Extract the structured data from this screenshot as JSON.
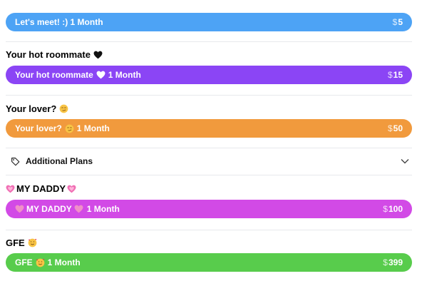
{
  "plans": [
    {
      "heading": "",
      "label": "Let's meet! :) 1 Month",
      "currency": "$",
      "amount": "5",
      "color": "#4da3f5"
    },
    {
      "heading": "Your hot roommate",
      "label": "Your hot roommate",
      "duration": "1 Month",
      "currency": "$",
      "amount": "15",
      "color": "#8b45f5",
      "emoji": "black-heart"
    },
    {
      "heading": "Your lover?",
      "label": "Your lover?",
      "duration": "1 Month",
      "currency": "$",
      "amount": "50",
      "color": "#f19a3d",
      "emoji": "smirking-face"
    },
    {
      "heading": "MY DADDY",
      "label": "MY DADDY",
      "duration": "1 Month",
      "currency": "$",
      "amount": "100",
      "color": "#d24ae6",
      "emoji": "growing-heart"
    },
    {
      "heading": "GFE",
      "label": "GFE",
      "duration": "1 Month",
      "currency": "$",
      "amount": "399",
      "color": "#58cc4c",
      "emoji": "smiling-face-with-hearts"
    }
  ],
  "additional": {
    "label": "Additional Plans",
    "icon": "tag-icon",
    "toggle_icon": "chevron-down-icon"
  }
}
